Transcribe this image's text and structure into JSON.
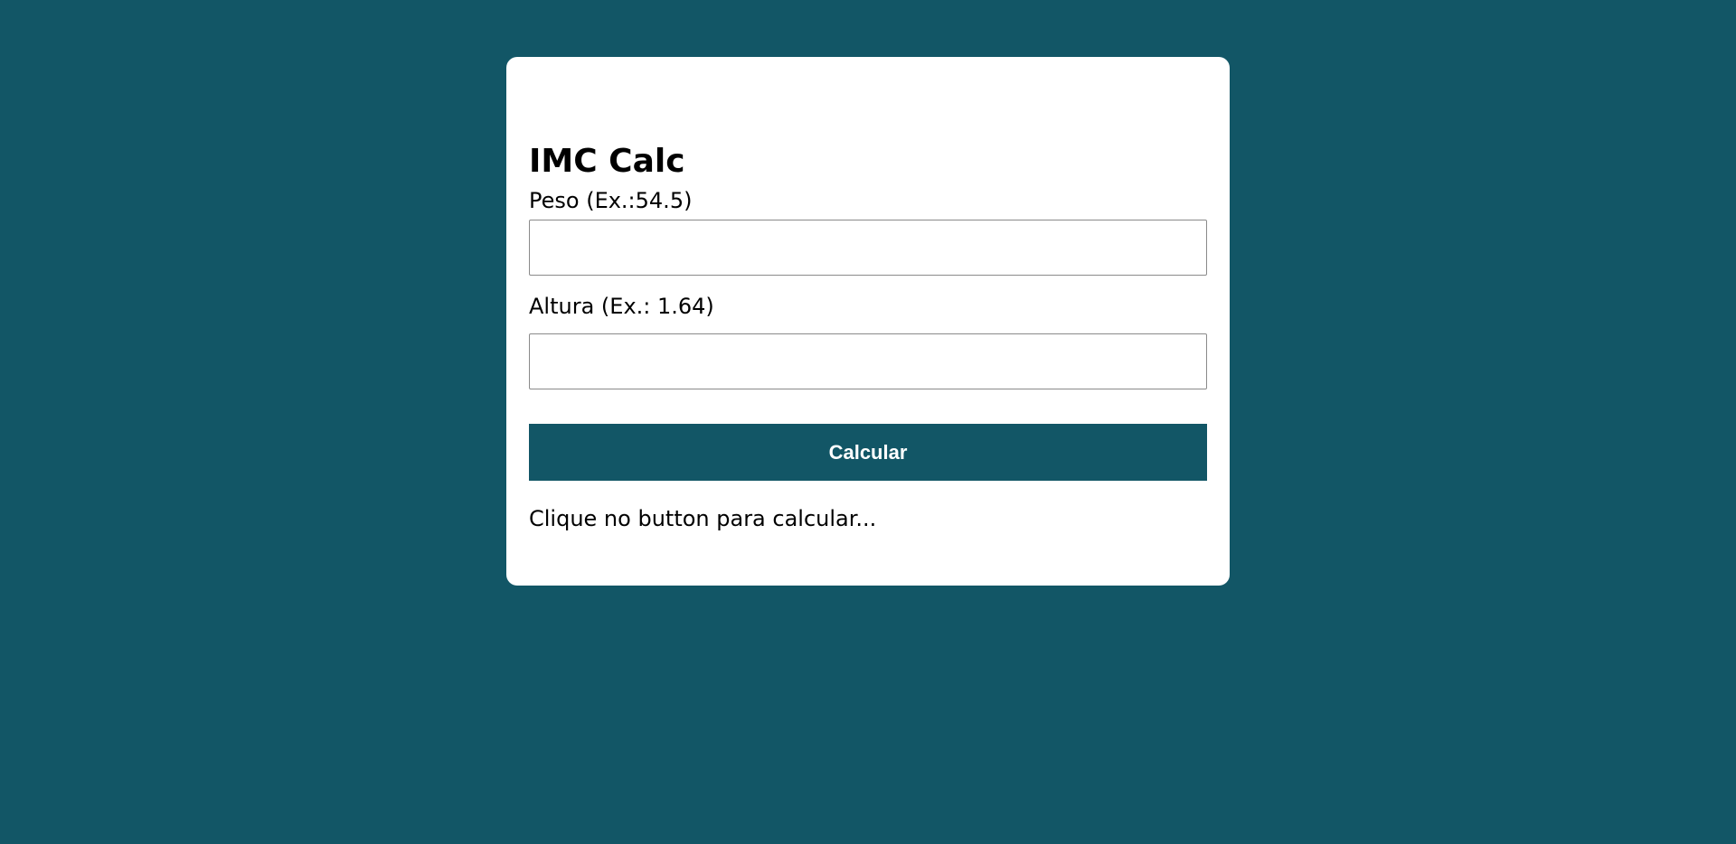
{
  "form": {
    "title": "IMC Calc",
    "peso_label": "Peso (Ex.:54.5)",
    "peso_value": "",
    "altura_label": "Altura (Ex.: 1.64)",
    "altura_value": "",
    "button_label": "Calcular",
    "result_text": "Clique no button para calcular..."
  },
  "colors": {
    "background": "#125666",
    "card": "#ffffff",
    "button": "#125666",
    "button_text": "#ffffff"
  }
}
